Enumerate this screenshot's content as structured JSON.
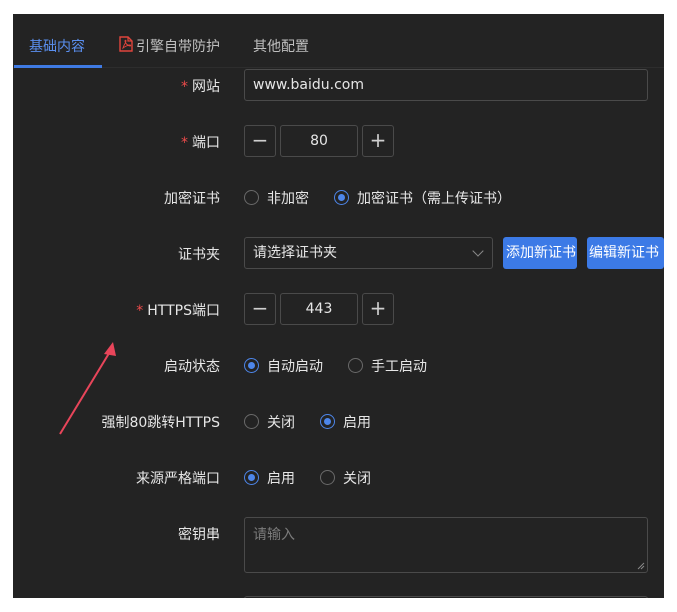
{
  "tabs": [
    {
      "label": "基础内容",
      "active": true
    },
    {
      "label": "引擎自带防护",
      "active": false,
      "icon": "pdf-icon"
    },
    {
      "label": "其他配置",
      "active": false
    }
  ],
  "form": {
    "website": {
      "label": "网站",
      "required": true,
      "value": "www.baidu.com"
    },
    "port": {
      "label": "端口",
      "required": true,
      "value": "80",
      "minus": "−",
      "plus": "+"
    },
    "encryption": {
      "label": "加密证书",
      "options": [
        "非加密",
        "加密证书（需上传证书）"
      ],
      "selected": "加密证书（需上传证书）"
    },
    "cert_folder": {
      "label": "证书夹",
      "placeholder": "请选择证书夹",
      "add_button": "添加新证书",
      "edit_button": "编辑新证书"
    },
    "https_port": {
      "label": "HTTPS端口",
      "required": true,
      "value": "443",
      "minus": "−",
      "plus": "+"
    },
    "start_status": {
      "label": "启动状态",
      "options": [
        "自动启动",
        "手工启动"
      ],
      "selected": "自动启动"
    },
    "force_https": {
      "label": "强制80跳转HTTPS",
      "options": [
        "关闭",
        "启用"
      ],
      "selected": "启用"
    },
    "strict_port": {
      "label": "来源严格端口",
      "options": [
        "启用",
        "关闭"
      ],
      "selected": "启用"
    },
    "secret": {
      "label": "密钥串",
      "placeholder": "请输入"
    }
  },
  "colors": {
    "background": "#232323",
    "accent": "#3c7ae6",
    "required": "#ee4b4b",
    "annotation_arrow": "#e8455a"
  }
}
